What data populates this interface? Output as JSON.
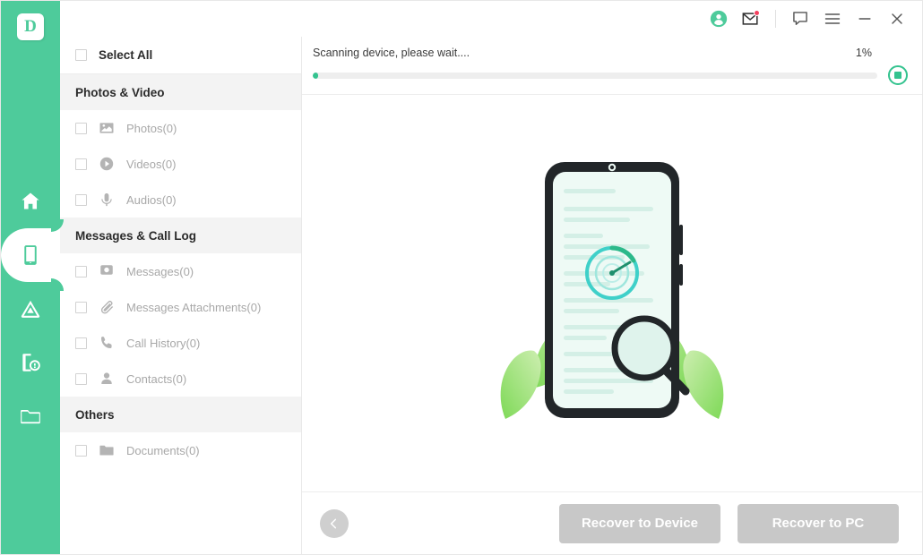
{
  "app": {
    "logo_letter": "D",
    "accent_color": "#4ecb9b",
    "progress_color": "#34c38f",
    "disabled_color": "#c8c8c8"
  },
  "titlebar": {
    "buttons": [
      {
        "name": "account-icon",
        "label": "Account"
      },
      {
        "name": "mail-icon",
        "label": "Messages"
      },
      {
        "name": "feedback-icon",
        "label": "Feedback"
      },
      {
        "name": "menu-icon",
        "label": "Menu"
      },
      {
        "name": "minimize-icon",
        "label": "Minimize"
      },
      {
        "name": "close-icon",
        "label": "Close"
      }
    ]
  },
  "rail": {
    "items": [
      {
        "name": "sidebar-item-home",
        "label": "Home",
        "active": false
      },
      {
        "name": "sidebar-item-phone",
        "label": "Phone Recovery",
        "active": true
      },
      {
        "name": "sidebar-item-cloud",
        "label": "Cloud Recovery",
        "active": false
      },
      {
        "name": "sidebar-item-repair",
        "label": "System Repair",
        "active": false
      },
      {
        "name": "sidebar-item-files",
        "label": "Files",
        "active": false
      }
    ]
  },
  "filelist": {
    "select_all_label": "Select All",
    "groups": [
      {
        "title": "Photos & Video",
        "items": [
          {
            "label": "Photos(0)",
            "icon": "photo-icon"
          },
          {
            "label": "Videos(0)",
            "icon": "video-icon"
          },
          {
            "label": "Audios(0)",
            "icon": "audio-icon"
          }
        ]
      },
      {
        "title": "Messages & Call Log",
        "items": [
          {
            "label": "Messages(0)",
            "icon": "message-icon"
          },
          {
            "label": "Messages Attachments(0)",
            "icon": "attachment-icon"
          },
          {
            "label": "Call History(0)",
            "icon": "call-icon"
          },
          {
            "label": "Contacts(0)",
            "icon": "contact-icon"
          }
        ]
      },
      {
        "title": "Others",
        "items": [
          {
            "label": "Documents(0)",
            "icon": "document-icon"
          }
        ]
      }
    ]
  },
  "progress": {
    "message": "Scanning device, please wait....",
    "percent_label": "1%",
    "percent_value": 1
  },
  "footer": {
    "back_label": "Back",
    "recover_to_device_label": "Recover to Device",
    "recover_to_pc_label": "Recover to PC"
  }
}
